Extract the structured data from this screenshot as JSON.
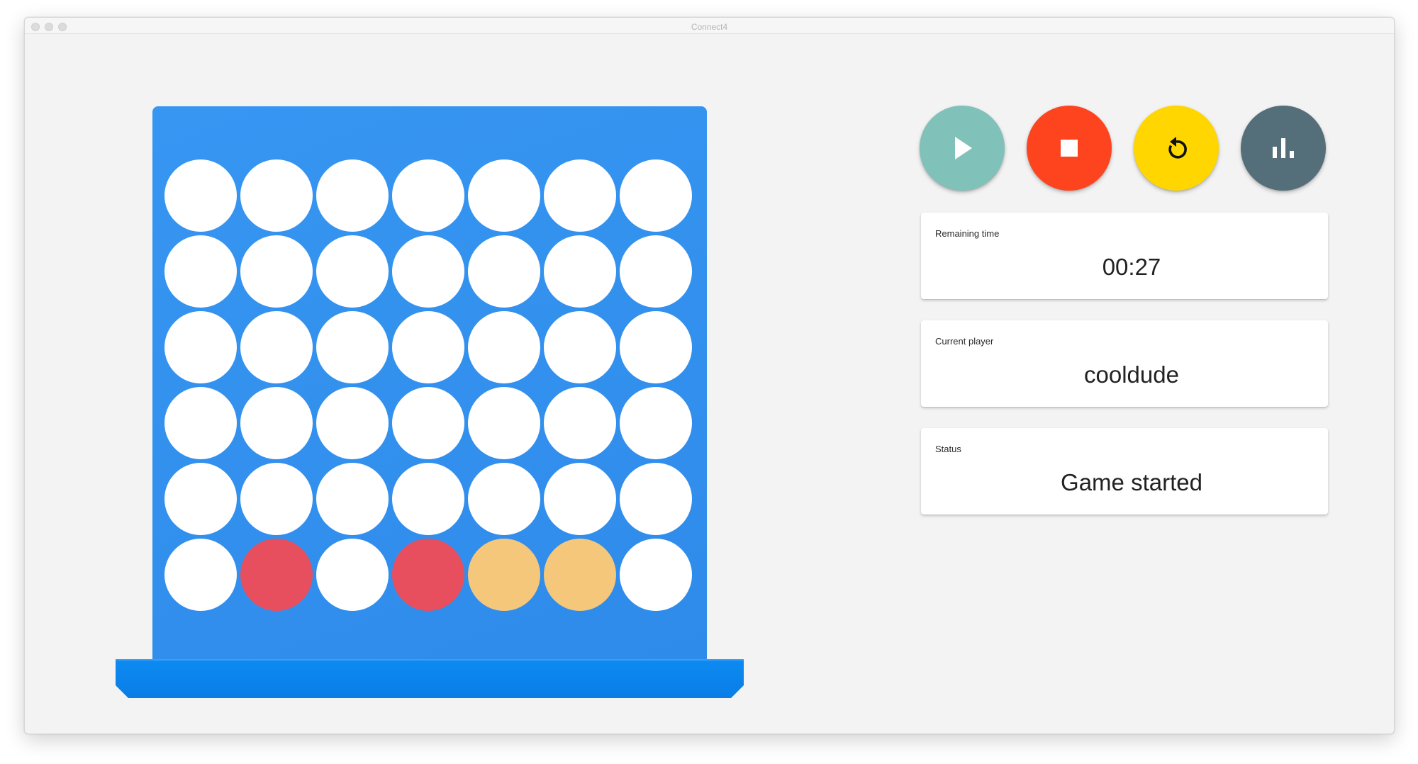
{
  "window": {
    "title": "Connect4"
  },
  "board": {
    "rows": 6,
    "columns": 7,
    "cells": [
      [
        "empty",
        "empty",
        "empty",
        "empty",
        "empty",
        "empty",
        "empty"
      ],
      [
        "empty",
        "empty",
        "empty",
        "empty",
        "empty",
        "empty",
        "empty"
      ],
      [
        "empty",
        "empty",
        "empty",
        "empty",
        "empty",
        "empty",
        "empty"
      ],
      [
        "empty",
        "empty",
        "empty",
        "empty",
        "empty",
        "empty",
        "empty"
      ],
      [
        "empty",
        "empty",
        "empty",
        "empty",
        "empty",
        "empty",
        "empty"
      ],
      [
        "empty",
        "red",
        "empty",
        "red",
        "yellow",
        "yellow",
        "empty"
      ]
    ],
    "colors": {
      "board": "#3394ef",
      "base": "#0a84ee",
      "red": "#e84f5e",
      "yellow": "#f4c77a",
      "empty": "#ffffff"
    }
  },
  "controls": [
    {
      "name": "play-button",
      "icon": "play-icon",
      "color": "#80c1b9"
    },
    {
      "name": "stop-button",
      "icon": "stop-icon",
      "color": "#fd441e"
    },
    {
      "name": "restart-button",
      "icon": "restart-icon",
      "color": "#ffd600"
    },
    {
      "name": "stats-button",
      "icon": "bar-chart-icon",
      "color": "#546e7a"
    }
  ],
  "info": {
    "remaining_time": {
      "label": "Remaining time",
      "value": "00:27"
    },
    "current_player": {
      "label": "Current player",
      "value": "cooldude"
    },
    "status": {
      "label": "Status",
      "value": "Game started"
    }
  }
}
